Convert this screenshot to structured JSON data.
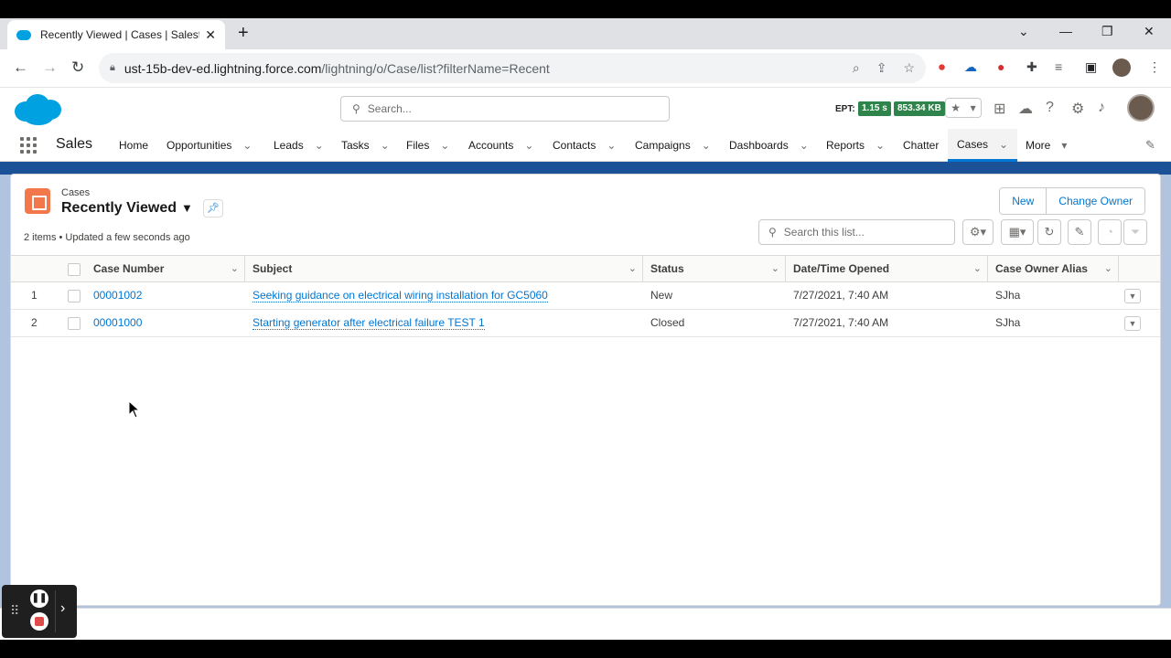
{
  "browser": {
    "tab_title": "Recently Viewed | Cases | Salesfo",
    "url_host": "ust-15b-dev-ed.lightning.force.com",
    "url_path": "/lightning/o/Case/list?filterName=Recent"
  },
  "sf_header": {
    "search_placeholder": "Search...",
    "ept_label": "EPT:",
    "ept_time": "1.15 s",
    "ept_size": "853.34 KB"
  },
  "nav": {
    "app_name": "Sales",
    "items": [
      {
        "label": "Home"
      },
      {
        "label": "Opportunities"
      },
      {
        "label": "Leads"
      },
      {
        "label": "Tasks"
      },
      {
        "label": "Files"
      },
      {
        "label": "Accounts"
      },
      {
        "label": "Contacts"
      },
      {
        "label": "Campaigns"
      },
      {
        "label": "Dashboards"
      },
      {
        "label": "Reports"
      },
      {
        "label": "Chatter"
      },
      {
        "label": "Cases"
      },
      {
        "label": "More"
      }
    ]
  },
  "list": {
    "object_label": "Cases",
    "view_name": "Recently Viewed",
    "meta": "2 items • Updated a few seconds ago",
    "new_button": "New",
    "change_owner_button": "Change Owner",
    "search_placeholder": "Search this list...",
    "columns": [
      "Case Number",
      "Subject",
      "Status",
      "Date/Time Opened",
      "Case Owner Alias"
    ],
    "rows": [
      {
        "num": "1",
        "case_number": "00001002",
        "subject": "Seeking guidance on electrical wiring installation for GC5060",
        "status": "New",
        "opened": "7/27/2021, 7:40 AM",
        "owner": "SJha"
      },
      {
        "num": "2",
        "case_number": "00001000",
        "subject": "Starting generator after electrical failure TEST 1",
        "status": "Closed",
        "opened": "7/27/2021, 7:40 AM",
        "owner": "SJha"
      }
    ]
  },
  "colors": {
    "brand_blue": "#0176d3",
    "case_icon": "#f2784b",
    "ept_green": "#2e844a"
  }
}
